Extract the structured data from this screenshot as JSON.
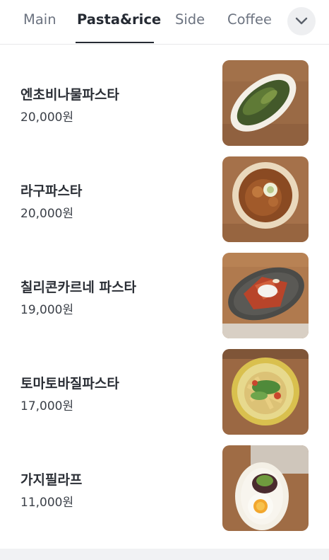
{
  "tabs": [
    {
      "label": "Main",
      "active": false
    },
    {
      "label": "Pasta&rice",
      "active": true
    },
    {
      "label": "Side",
      "active": false
    },
    {
      "label": "Coffee",
      "active": false
    }
  ],
  "expand_icon": "chevron-down-icon",
  "colors": {
    "active_tab": "#252a33",
    "inactive_tab": "#6c7380",
    "divider": "#e9e9ea",
    "expand_button_bg": "#eeeff1"
  },
  "menu": [
    {
      "name": "엔초비나물파스타",
      "price": "20,000원",
      "image": "anchovy-herb-pasta-photo"
    },
    {
      "name": "라구파스타",
      "price": "20,000원",
      "image": "ragu-pasta-photo"
    },
    {
      "name": "칠리콘카르네 파스타",
      "price": "19,000원",
      "image": "chili-con-carne-pasta-photo"
    },
    {
      "name": "토마토바질파스타",
      "price": "17,000원",
      "image": "tomato-basil-pasta-photo"
    },
    {
      "name": "가지필라프",
      "price": "11,000원",
      "image": "eggplant-pilaf-photo"
    }
  ]
}
